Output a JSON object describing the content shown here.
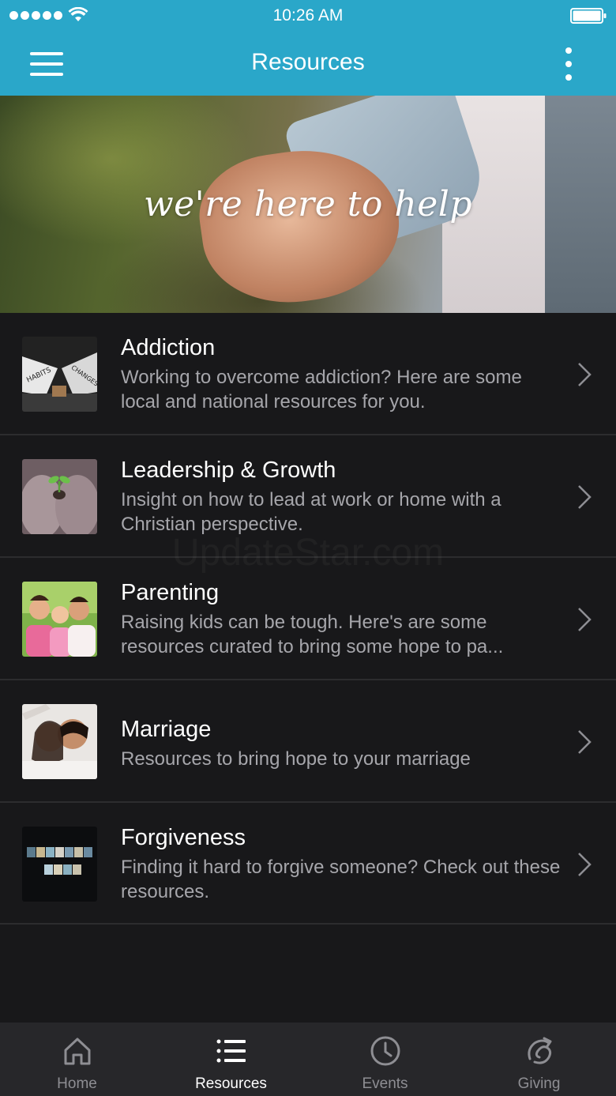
{
  "status_bar": {
    "time": "10:26 AM"
  },
  "app_bar": {
    "title": "Resources"
  },
  "hero": {
    "tagline": "we're here to help"
  },
  "resources": [
    {
      "title": "Addiction",
      "description": "Working to overcome addiction? Here are some local and national resources for you.",
      "thumb_icon": "habits-changes-thumbnail"
    },
    {
      "title": "Leadership & Growth",
      "description": "Insight on how to lead at work or home with a Christian perspective.",
      "thumb_icon": "sprout-hands-thumbnail"
    },
    {
      "title": "Parenting",
      "description": "Raising kids can be tough. Here's are some resources curated to bring some hope to pa...",
      "thumb_icon": "family-thumbnail"
    },
    {
      "title": "Marriage",
      "description": "Resources to bring hope to your marriage",
      "thumb_icon": "couple-thumbnail"
    },
    {
      "title": "Forgiveness",
      "description": "Finding it hard to forgive someone? Check out these resources.",
      "thumb_icon": "forgiveness-thumbnail"
    }
  ],
  "watermark": "UpdateStar.com",
  "tab_bar": {
    "tabs": [
      {
        "label": "Home",
        "icon": "home-icon",
        "active": false
      },
      {
        "label": "Resources",
        "icon": "list-icon",
        "active": true
      },
      {
        "label": "Events",
        "icon": "clock-icon",
        "active": false
      },
      {
        "label": "Giving",
        "icon": "giving-icon",
        "active": false
      }
    ]
  },
  "colors": {
    "accent": "#2aa7c9",
    "background": "#18181a",
    "tab_bar": "#27272a",
    "secondary_text": "#a6a6ab"
  }
}
